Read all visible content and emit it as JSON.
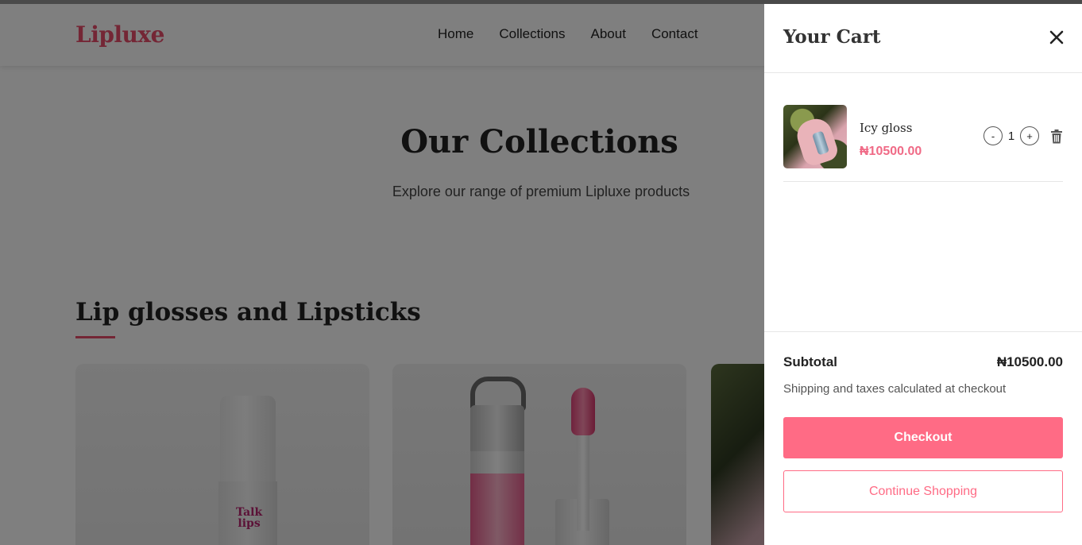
{
  "site": {
    "logo": "Lipluxe",
    "nav": [
      "Home",
      "Collections",
      "About",
      "Contact"
    ]
  },
  "hero": {
    "title": "Our Collections",
    "subtitle": "Explore our range of premium Lipluxe products"
  },
  "section": {
    "title": "Lip glosses and Lipsticks",
    "card1_label": "Talk\nlips"
  },
  "cart": {
    "title": "Your Cart",
    "items": [
      {
        "name": "Icy gloss",
        "price": "₦10500.00",
        "quantity": "1",
        "minus": "-",
        "plus": "+"
      }
    ],
    "subtotal_label": "Subtotal",
    "subtotal_value": "₦10500.00",
    "shipping_note": "Shipping and taxes calculated at checkout",
    "checkout_label": "Checkout",
    "continue_label": "Continue Shopping"
  },
  "colors": {
    "accent": "#ff6b85",
    "brand": "#e84c6b",
    "overlay": "rgba(0,0,0,0.5)"
  },
  "icons": [
    "close-icon",
    "trash-icon"
  ]
}
